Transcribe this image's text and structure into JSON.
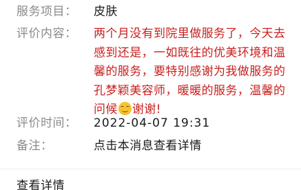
{
  "rows": {
    "service": {
      "label": "服务项目：",
      "value": "皮肤"
    },
    "content": {
      "label": "评价内容：",
      "text_before_emoji": "两个月没有到院里做服务了，今天去感到还是，一如既往的优美环境和温馨的服务，要特别感谢为我做服务的孔梦颖美容师，暖暖的服务，温馨的问候",
      "emoji": "smiling-face-emoji",
      "text_after_emoji": "谢谢!"
    },
    "time": {
      "label": "评价时间：",
      "value": "2022-04-07 19:31"
    },
    "note": {
      "label": "备注：",
      "value": "点击本消息查看详情"
    }
  },
  "footer": {
    "link_label": "查看详情"
  },
  "colors": {
    "label": "#8a8a8a",
    "value": "#1a1a1a",
    "highlight": "#c8201f",
    "divider": "#ececec"
  }
}
